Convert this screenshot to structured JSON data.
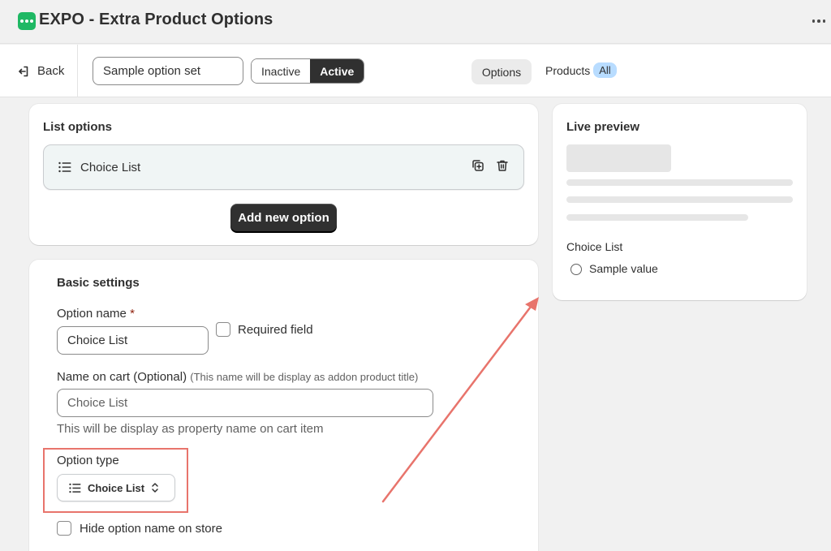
{
  "app": {
    "title": "EXPO - Extra Product Options",
    "brand_color": "#1fb864"
  },
  "toolbar": {
    "back_label": "Back",
    "option_set_name": "Sample option set",
    "status_inactive": "Inactive",
    "status_active": "Active",
    "status_selected": "Active",
    "tab_options": "Options",
    "tab_products": "Products",
    "products_badge": "All"
  },
  "list_options": {
    "title": "List options",
    "items": [
      {
        "label": "Choice List",
        "icon": "list-icon"
      }
    ],
    "add_button": "Add new option"
  },
  "basic_settings": {
    "title": "Basic settings",
    "option_name_label": "Option name",
    "required_marker": "*",
    "option_name_value": "Choice List",
    "required_field_label": "Required field",
    "required_field_checked": false,
    "cart_name_label": "Name on cart (Optional)",
    "cart_name_hint": "(This name will be display as addon product title)",
    "cart_name_placeholder": "Choice List",
    "cart_name_help": "This will be display as property name on cart item",
    "option_type_label": "Option type",
    "option_type_value": "Choice List",
    "hide_name_label": "Hide option name on store",
    "hide_name_checked": false
  },
  "live_preview": {
    "title": "Live preview",
    "option_label": "Choice List",
    "sample_value": "Sample value"
  },
  "annotation": {
    "highlight_color": "#e8746c"
  }
}
